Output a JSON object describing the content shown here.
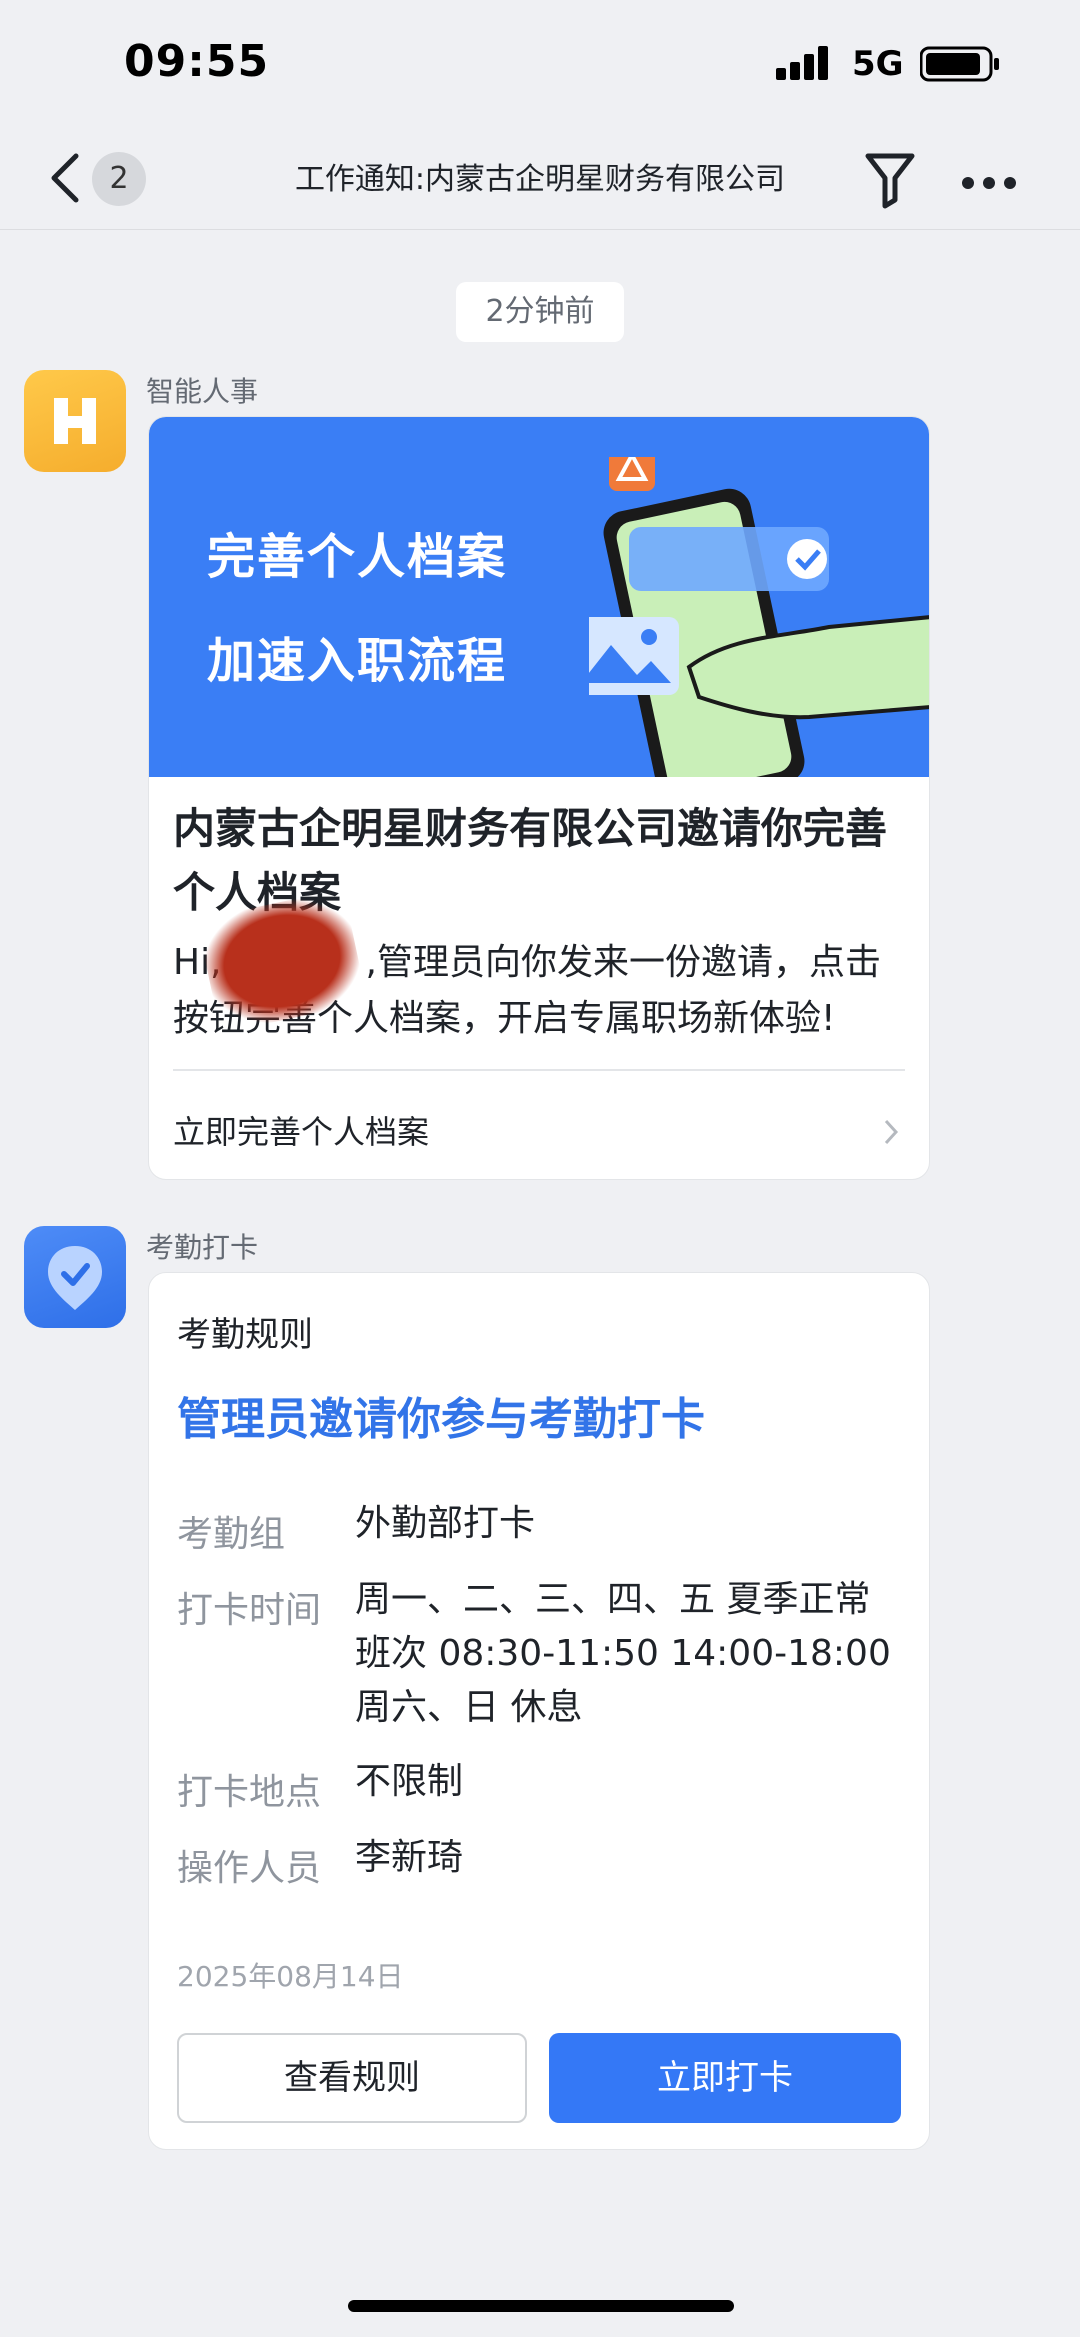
{
  "status_bar": {
    "time": "09:55",
    "network": "5G"
  },
  "nav": {
    "badge_count": "2",
    "title": "工作通知:内蒙古企明星财务有限公司"
  },
  "timestamp": "2分钟前",
  "message_hr": {
    "sender": "智能人事",
    "banner_line1": "完善个人档案",
    "banner_line2": "加速入职流程",
    "title": "内蒙古企明星财务有限公司邀请你完善个人档案",
    "body": "Hi,　　　　,管理员向你发来一份邀请，点击按钮完善个人档案，开启专属职场新体验!",
    "link_label": "立即完善个人档案"
  },
  "message_attendance": {
    "sender": "考勤打卡",
    "header": "考勤规则",
    "title": "管理员邀请你参与考勤打卡",
    "rows": [
      {
        "label": "考勤组",
        "value": "外勤部打卡"
      },
      {
        "label": "打卡时间",
        "value": "周一、二、三、四、五 夏季正常班次 08:30-11:50 14:00-18:00 周六、日 休息"
      },
      {
        "label": "打卡地点",
        "value": "不限制"
      },
      {
        "label": "操作人员",
        "value": "李新琦"
      }
    ],
    "date": "2025年08月14日",
    "btn_rules": "查看规则",
    "btn_punch": "立即打卡"
  },
  "colors": {
    "accent": "#3478f6",
    "banner": "#3a7ef5",
    "hr_avatar": "#f5ad2d",
    "background": "#eff0f3"
  }
}
